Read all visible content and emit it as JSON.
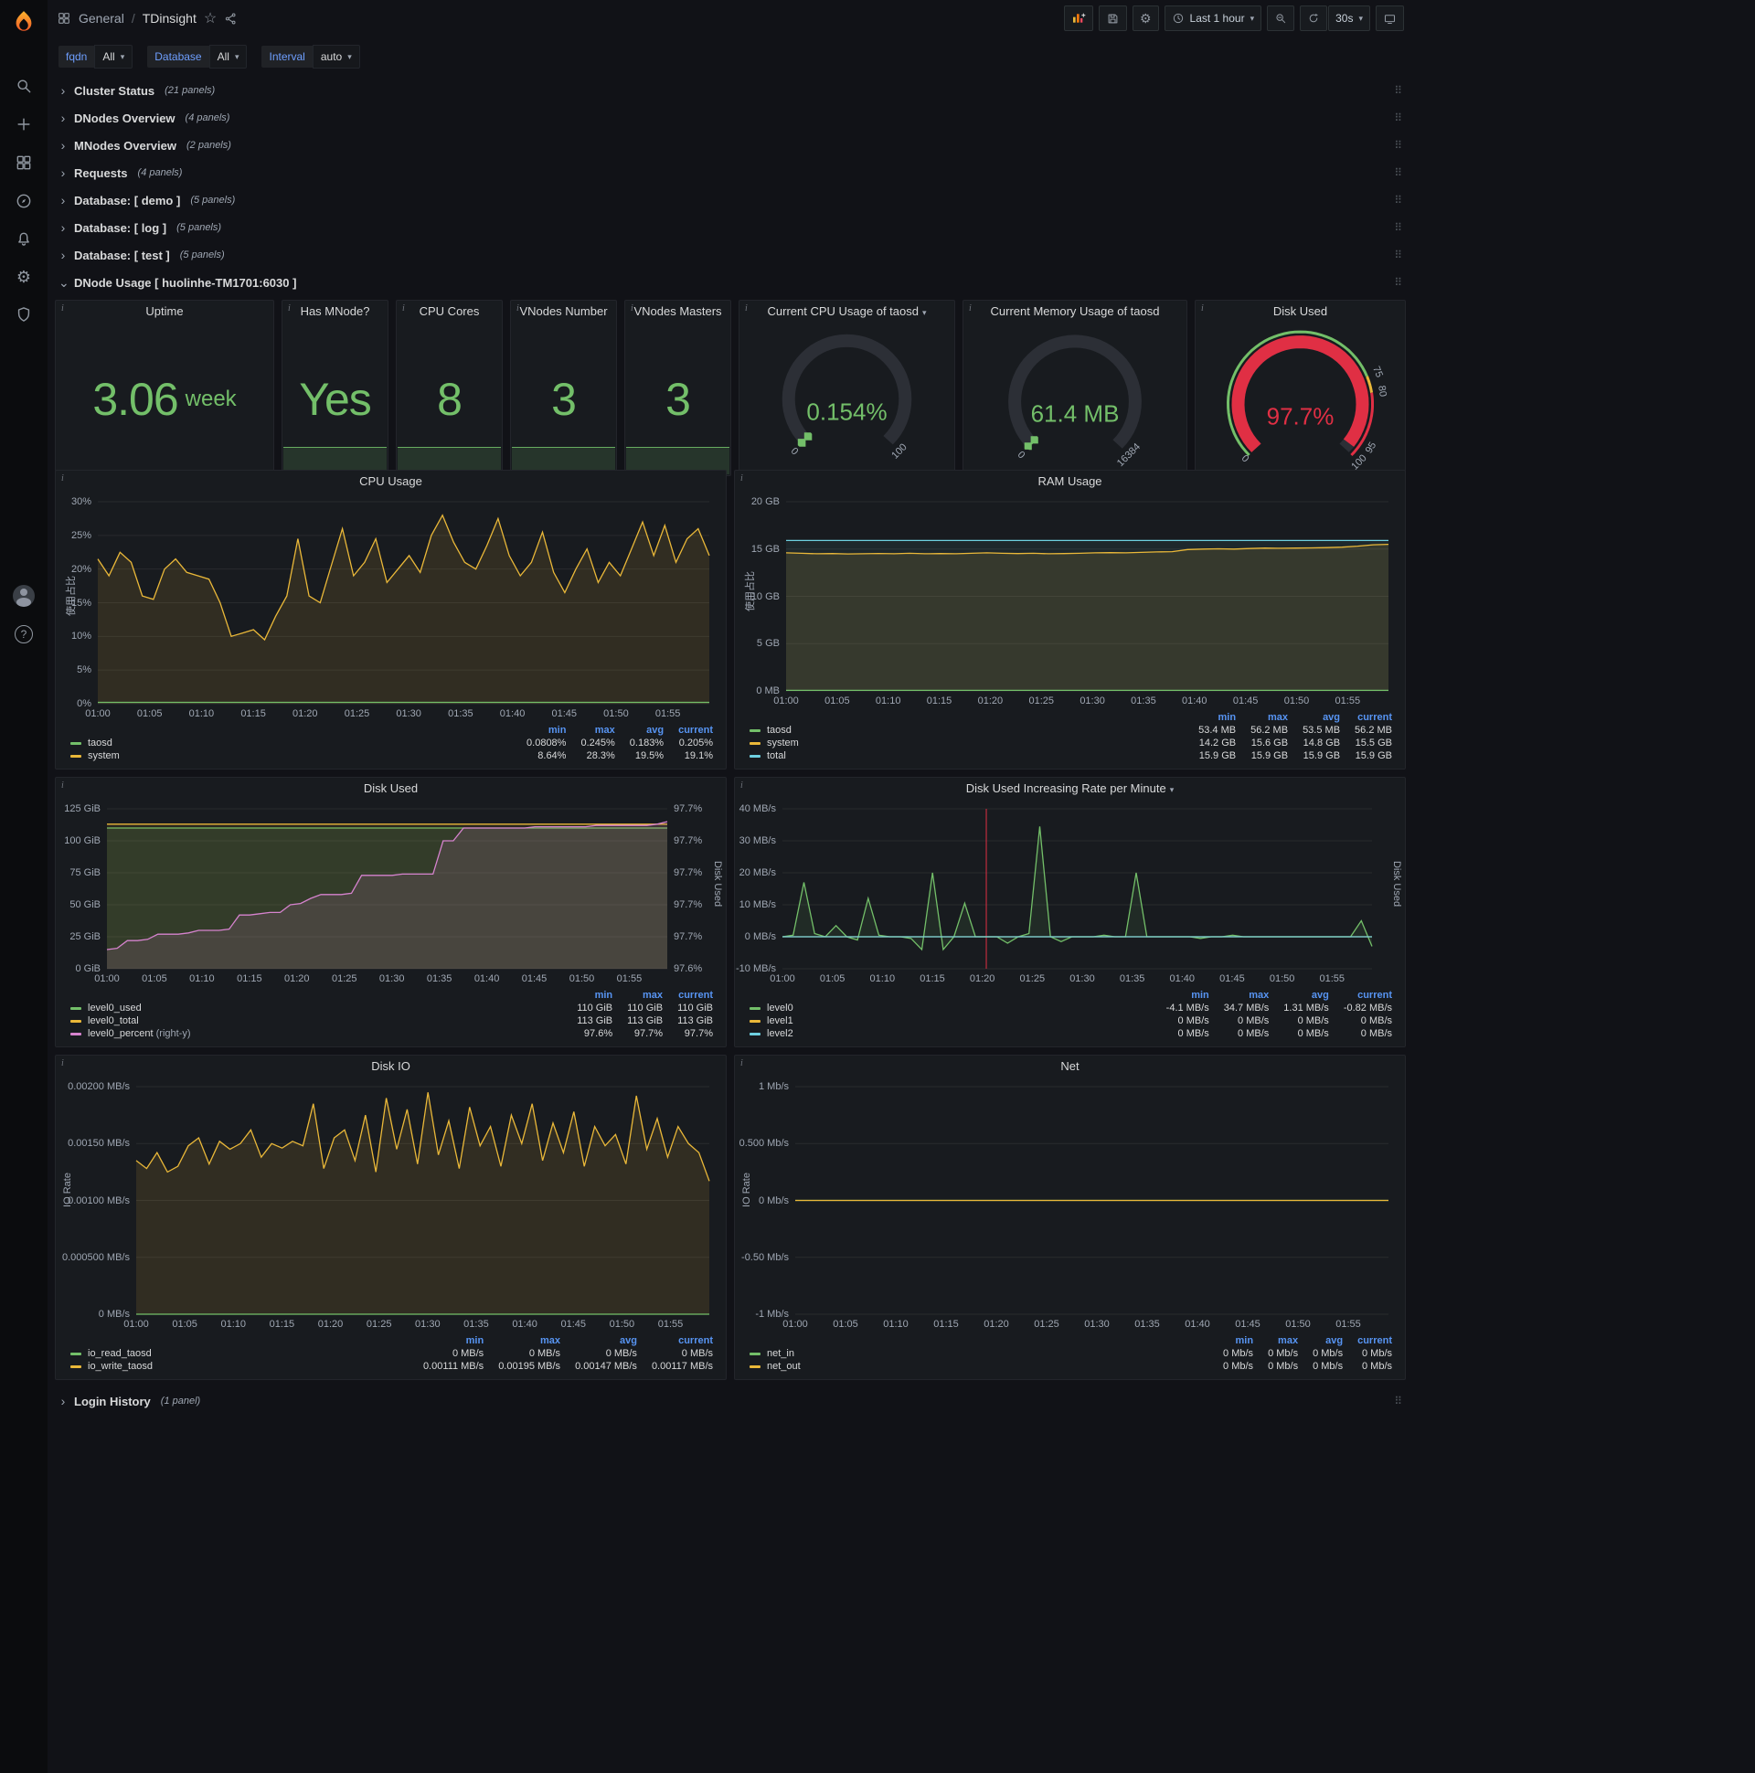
{
  "colors": {
    "green": "#73bf69",
    "yellow": "#eab839",
    "cyan": "#6ed0e0",
    "blue": "#5794f2",
    "pink": "#d683ce",
    "red": "#e02f44",
    "orange": "#ff780a"
  },
  "icons": {
    "caret": "▾",
    "chevron_right": "›",
    "chevron_down": "⌄",
    "drag": "⠿",
    "star": "☆",
    "question": "?"
  },
  "nav": {
    "folder": "General",
    "separator": "/",
    "title": "TDinsight",
    "time_range": "Last 1 hour",
    "refresh": "30s"
  },
  "filters": [
    {
      "label": "fqdn",
      "value": "All"
    },
    {
      "label": "Database",
      "value": "All"
    },
    {
      "label": "Interval",
      "value": "auto"
    }
  ],
  "rows": {
    "collapsed_top": [
      {
        "title": "Cluster Status",
        "count": "(21 panels)"
      },
      {
        "title": "DNodes Overview",
        "count": "(4 panels)"
      },
      {
        "title": "MNodes Overview",
        "count": "(2 panels)"
      },
      {
        "title": "Requests",
        "count": "(4 panels)"
      },
      {
        "title": "Database: [ demo ]",
        "count": "(5 panels)"
      },
      {
        "title": "Database: [ log ]",
        "count": "(5 panels)"
      },
      {
        "title": "Database: [ test ]",
        "count": "(5 panels)"
      }
    ],
    "expanded": {
      "title": "DNode Usage [ huolinhe-TM1701:6030 ]",
      "count": ""
    },
    "collapsed_bottom": [
      {
        "title": "Login History",
        "count": "(1 panel)"
      }
    ]
  },
  "stat_panels": [
    {
      "title": "Uptime",
      "value": "3.06",
      "unit": "week",
      "spark": false
    },
    {
      "title": "Has MNode?",
      "value": "Yes",
      "unit": "",
      "spark": true
    },
    {
      "title": "CPU Cores",
      "value": "8",
      "unit": "",
      "spark": true
    },
    {
      "title": "VNodes Number",
      "value": "3",
      "unit": "",
      "spark": true
    },
    {
      "title": "VNodes Masters",
      "value": "3",
      "unit": "",
      "spark": true
    }
  ],
  "gauge_panels": [
    {
      "title": "Current CPU Usage of taosd",
      "has_menu": true,
      "value": "0.154%",
      "min_label": "0",
      "max_label": "100",
      "fraction": 0.0015,
      "value_color": "green",
      "band": false,
      "thresholds": []
    },
    {
      "title": "Current Memory Usage of taosd",
      "has_menu": false,
      "value": "61.4 MB",
      "min_label": "0",
      "max_label": "16384",
      "fraction": 0.0037,
      "value_color": "green",
      "band": false,
      "thresholds": []
    },
    {
      "title": "Disk Used",
      "has_menu": false,
      "value": "97.7%",
      "min_label": "0",
      "max_label": "",
      "fraction": 0.977,
      "value_color": "red",
      "band": true,
      "thresholds": [
        {
          "v": 75,
          "l": "75"
        },
        {
          "v": 80,
          "l": "80"
        },
        {
          "v": 95,
          "l": "95"
        },
        {
          "v": 100,
          "l": "100"
        }
      ]
    }
  ],
  "time_axis": {
    "xlim": [
      0,
      59
    ],
    "ticks": [
      {
        "v": 0,
        "l": "01:00"
      },
      {
        "v": 5,
        "l": "01:05"
      },
      {
        "v": 10,
        "l": "01:10"
      },
      {
        "v": 15,
        "l": "01:15"
      },
      {
        "v": 20,
        "l": "01:20"
      },
      {
        "v": 25,
        "l": "01:25"
      },
      {
        "v": 30,
        "l": "01:30"
      },
      {
        "v": 35,
        "l": "01:35"
      },
      {
        "v": 40,
        "l": "01:40"
      },
      {
        "v": 45,
        "l": "01:45"
      },
      {
        "v": 50,
        "l": "01:50"
      },
      {
        "v": 55,
        "l": "01:55"
      }
    ]
  },
  "chart_data": [
    {
      "id": "cpu",
      "type": "line",
      "title": "CPU Usage",
      "has_menu": false,
      "ylabel": "使用占比",
      "ylim": [
        0,
        30
      ],
      "yticks": [
        {
          "v": 0,
          "l": "0%"
        },
        {
          "v": 5,
          "l": "5%"
        },
        {
          "v": 10,
          "l": "10%"
        },
        {
          "v": 15,
          "l": "15%"
        },
        {
          "v": 20,
          "l": "20%"
        },
        {
          "v": 25,
          "l": "25%"
        },
        {
          "v": 30,
          "l": "30%"
        }
      ],
      "series": [
        {
          "name": "system",
          "color": "yellow",
          "fill": true,
          "fill_alpha": 0.12,
          "points": [
            21.5,
            19,
            22.5,
            21,
            16,
            15.5,
            20,
            21.5,
            19.5,
            19,
            18.5,
            15,
            10,
            10.5,
            11,
            9.5,
            13,
            16,
            24.5,
            16,
            15,
            20.5,
            26,
            19,
            21,
            24.5,
            18,
            20,
            22,
            19.5,
            25,
            28,
            24,
            21,
            20,
            23.5,
            27.5,
            22,
            19,
            21,
            25.5,
            19.5,
            16.5,
            20,
            23,
            18,
            21,
            19,
            23,
            27,
            22,
            26.5,
            21,
            24.5,
            26,
            22
          ]
        },
        {
          "name": "taosd",
          "color": "green",
          "fill": false,
          "points": [
            0.2,
            0.2
          ]
        }
      ],
      "legend": {
        "cols": [
          "min",
          "max",
          "avg",
          "current"
        ],
        "rows": [
          {
            "name": "taosd",
            "color": "green",
            "vals": [
              "0.0808%",
              "0.245%",
              "0.183%",
              "0.205%"
            ]
          },
          {
            "name": "system",
            "color": "yellow",
            "vals": [
              "8.64%",
              "28.3%",
              "19.5%",
              "19.1%"
            ]
          }
        ]
      }
    },
    {
      "id": "ram",
      "type": "line",
      "title": "RAM Usage",
      "has_menu": false,
      "ylabel": "使用占比",
      "ylim": [
        0,
        20
      ],
      "yticks": [
        {
          "v": 0,
          "l": "0 MB"
        },
        {
          "v": 5,
          "l": "5 GB"
        },
        {
          "v": 10,
          "l": "10 GB"
        },
        {
          "v": 15,
          "l": "15 GB"
        },
        {
          "v": 20,
          "l": "20 GB"
        }
      ],
      "series": [
        {
          "name": "total",
          "color": "cyan",
          "fill": true,
          "fill_alpha": 0.07,
          "points": [
            15.9,
            15.9
          ]
        },
        {
          "name": "system",
          "color": "yellow",
          "fill": true,
          "fill_alpha": 0.12,
          "points": [
            14.6,
            14.55,
            14.5,
            14.52,
            14.48,
            14.5,
            14.53,
            14.5,
            14.55,
            14.5,
            14.52,
            14.5,
            14.55,
            14.6,
            14.55,
            14.52,
            14.55,
            14.5,
            14.52,
            14.55,
            14.6,
            14.62,
            14.6,
            14.65,
            14.7,
            14.72,
            14.95,
            15.0,
            15.02,
            15.0,
            15.05,
            15.1,
            15.08,
            15.1,
            15.12,
            15.15,
            15.2,
            15.3,
            15.45,
            15.5
          ]
        },
        {
          "name": "taosd",
          "color": "green",
          "fill": false,
          "points": [
            0.055,
            0.055
          ]
        }
      ],
      "legend": {
        "cols": [
          "min",
          "max",
          "avg",
          "current"
        ],
        "rows": [
          {
            "name": "taosd",
            "color": "green",
            "vals": [
              "53.4 MB",
              "56.2 MB",
              "53.5 MB",
              "56.2 MB"
            ]
          },
          {
            "name": "system",
            "color": "yellow",
            "vals": [
              "14.2 GB",
              "15.6 GB",
              "14.8 GB",
              "15.5 GB"
            ]
          },
          {
            "name": "total",
            "color": "cyan",
            "vals": [
              "15.9 GB",
              "15.9 GB",
              "15.9 GB",
              "15.9 GB"
            ]
          }
        ]
      }
    },
    {
      "id": "disk",
      "type": "line",
      "title": "Disk Used",
      "has_menu": false,
      "ylim": [
        0,
        125
      ],
      "yticks": [
        {
          "v": 0,
          "l": "0 GiB"
        },
        {
          "v": 25,
          "l": "25 GiB"
        },
        {
          "v": 50,
          "l": "50 GiB"
        },
        {
          "v": 75,
          "l": "75 GiB"
        },
        {
          "v": 100,
          "l": "100 GiB"
        },
        {
          "v": 125,
          "l": "125 GiB"
        }
      ],
      "right_ylim": [
        97.59,
        97.715
      ],
      "right_yticks": [
        {
          "f": 0,
          "l": "97.6%"
        },
        {
          "f": 0.2,
          "l": "97.7%"
        },
        {
          "f": 0.4,
          "l": "97.7%"
        },
        {
          "f": 0.6,
          "l": "97.7%"
        },
        {
          "f": 0.8,
          "l": "97.7%"
        },
        {
          "f": 1,
          "l": "97.7%"
        }
      ],
      "right_ylabel": "Disk Used",
      "series": [
        {
          "name": "level0_used",
          "color": "green",
          "fill": true,
          "fill_alpha": 0.14,
          "points": [
            110,
            110
          ]
        },
        {
          "name": "level0_total",
          "color": "yellow",
          "fill": true,
          "fill_alpha": 0.08,
          "points": [
            113,
            113
          ]
        },
        {
          "name": "level0_percent",
          "color": "pink",
          "axis": "right",
          "fill": true,
          "fill_alpha": 0.13,
          "points": [
            97.605,
            97.606,
            97.612,
            97.612,
            97.613,
            97.617,
            97.617,
            97.617,
            97.618,
            97.62,
            97.62,
            97.62,
            97.621,
            97.632,
            97.632,
            97.633,
            97.634,
            97.634,
            97.64,
            97.641,
            97.645,
            97.648,
            97.648,
            97.648,
            97.649,
            97.663,
            97.663,
            97.663,
            97.663,
            97.664,
            97.664,
            97.664,
            97.664,
            97.69,
            97.69,
            97.7,
            97.7,
            97.7,
            97.7,
            97.7,
            97.7,
            97.7,
            97.701,
            97.701,
            97.701,
            97.701,
            97.701,
            97.701,
            97.702,
            97.702,
            97.702,
            97.702,
            97.702,
            97.702,
            97.703,
            97.705
          ]
        }
      ],
      "legend": {
        "cols": [
          "min",
          "max",
          "current"
        ],
        "rows": [
          {
            "name": "level0_used",
            "color": "green",
            "vals": [
              "110 GiB",
              "110 GiB",
              "110 GiB"
            ]
          },
          {
            "name": "level0_total",
            "color": "yellow",
            "vals": [
              "113 GiB",
              "113 GiB",
              "113 GiB"
            ]
          },
          {
            "name": "level0_percent",
            "suffix": "(right-y)",
            "color": "pink",
            "vals": [
              "97.6%",
              "97.7%",
              "97.7%"
            ]
          }
        ]
      }
    },
    {
      "id": "rate",
      "type": "line",
      "title": "Disk Used Increasing Rate per Minute",
      "has_menu": true,
      "ylim": [
        -10,
        40
      ],
      "yticks": [
        {
          "v": -10,
          "l": "-10 MB/s"
        },
        {
          "v": 0,
          "l": "0 MB/s"
        },
        {
          "v": 10,
          "l": "10 MB/s"
        },
        {
          "v": 20,
          "l": "20 MB/s"
        },
        {
          "v": 30,
          "l": "30 MB/s"
        },
        {
          "v": 40,
          "l": "40 MB/s"
        }
      ],
      "right_ylabel": "Disk Used",
      "annotations": [
        {
          "x": 20.4,
          "color": "red"
        }
      ],
      "series": [
        {
          "name": "level0",
          "color": "green",
          "fill": true,
          "fill_alpha": 0.1,
          "points": [
            0,
            0.5,
            17,
            1,
            0,
            3.5,
            0,
            -1,
            12,
            0.5,
            0,
            0,
            -0.5,
            -4,
            20,
            -4,
            0,
            10.5,
            0,
            0,
            0,
            -2,
            0,
            1,
            34.5,
            0,
            -1.5,
            0,
            0,
            0,
            0.5,
            0,
            0,
            20,
            0,
            0,
            0,
            0,
            0,
            -0.5,
            0,
            0,
            0.5,
            0,
            0,
            0,
            0,
            0,
            0,
            0,
            0,
            0,
            0,
            0,
            5,
            -3
          ]
        },
        {
          "name": "level1",
          "color": "yellow",
          "fill": false,
          "points": [
            0,
            0
          ]
        },
        {
          "name": "level2",
          "color": "cyan",
          "fill": false,
          "points": [
            0,
            0
          ]
        }
      ],
      "legend": {
        "cols": [
          "min",
          "max",
          "avg",
          "current"
        ],
        "rows": [
          {
            "name": "level0",
            "color": "green",
            "vals": [
              "-4.1 MB/s",
              "34.7 MB/s",
              "1.31 MB/s",
              "-0.82 MB/s"
            ]
          },
          {
            "name": "level1",
            "color": "yellow",
            "vals": [
              "0 MB/s",
              "0 MB/s",
              "0 MB/s",
              "0 MB/s"
            ]
          },
          {
            "name": "level2",
            "color": "cyan",
            "vals": [
              "0 MB/s",
              "0 MB/s",
              "0 MB/s",
              "0 MB/s"
            ]
          }
        ]
      }
    },
    {
      "id": "io",
      "type": "line",
      "title": "Disk IO",
      "has_menu": false,
      "ylabel": "IO Rate",
      "ylim": [
        0,
        0.002
      ],
      "yticks": [
        {
          "v": 0,
          "l": "0 MB/s"
        },
        {
          "v": 0.0005,
          "l": "0.000500 MB/s"
        },
        {
          "v": 0.001,
          "l": "0.00100 MB/s"
        },
        {
          "v": 0.0015,
          "l": "0.00150 MB/s"
        },
        {
          "v": 0.002,
          "l": "0.00200 MB/s"
        }
      ],
      "series": [
        {
          "name": "io_write_taosd",
          "color": "yellow",
          "fill": true,
          "fill_alpha": 0.12,
          "points": [
            0.00135,
            0.00128,
            0.00142,
            0.00125,
            0.0013,
            0.00148,
            0.00155,
            0.00132,
            0.00152,
            0.00145,
            0.0015,
            0.00162,
            0.00138,
            0.0015,
            0.00146,
            0.00152,
            0.00148,
            0.00185,
            0.00128,
            0.00155,
            0.00162,
            0.00135,
            0.00175,
            0.00125,
            0.0019,
            0.00145,
            0.0018,
            0.00132,
            0.00195,
            0.0014,
            0.0017,
            0.00128,
            0.00182,
            0.00148,
            0.00165,
            0.0013,
            0.00175,
            0.0015,
            0.00185,
            0.00135,
            0.00168,
            0.00142,
            0.00178,
            0.0013,
            0.00165,
            0.00148,
            0.00158,
            0.00132,
            0.00192,
            0.00145,
            0.00172,
            0.00138,
            0.00165,
            0.0015,
            0.00142,
            0.00117
          ]
        },
        {
          "name": "io_read_taosd",
          "color": "green",
          "fill": false,
          "points": [
            0,
            0
          ]
        }
      ],
      "legend": {
        "cols": [
          "min",
          "max",
          "avg",
          "current"
        ],
        "rows": [
          {
            "name": "io_read_taosd",
            "color": "green",
            "vals": [
              "0 MB/s",
              "0 MB/s",
              "0 MB/s",
              "0 MB/s"
            ]
          },
          {
            "name": "io_write_taosd",
            "color": "yellow",
            "vals": [
              "0.00111 MB/s",
              "0.00195 MB/s",
              "0.00147 MB/s",
              "0.00117 MB/s"
            ]
          }
        ]
      }
    },
    {
      "id": "net",
      "type": "line",
      "title": "Net",
      "has_menu": false,
      "ylabel": "IO Rate",
      "ylim": [
        -1,
        1
      ],
      "yticks": [
        {
          "v": -1,
          "l": "-1 Mb/s"
        },
        {
          "v": -0.5,
          "l": "-0.50 Mb/s"
        },
        {
          "v": 0,
          "l": "0 Mb/s"
        },
        {
          "v": 0.5,
          "l": "0.500 Mb/s"
        },
        {
          "v": 1,
          "l": "1 Mb/s"
        }
      ],
      "series": [
        {
          "name": "net_in",
          "color": "green",
          "fill": false,
          "points": [
            0,
            0
          ]
        },
        {
          "name": "net_out",
          "color": "yellow",
          "fill": false,
          "points": [
            0,
            0
          ]
        }
      ],
      "legend": {
        "cols": [
          "min",
          "max",
          "avg",
          "current"
        ],
        "rows": [
          {
            "name": "net_in",
            "color": "green",
            "vals": [
              "0 Mb/s",
              "0 Mb/s",
              "0 Mb/s",
              "0 Mb/s"
            ]
          },
          {
            "name": "net_out",
            "color": "yellow",
            "vals": [
              "0 Mb/s",
              "0 Mb/s",
              "0 Mb/s",
              "0 Mb/s"
            ]
          }
        ]
      }
    }
  ]
}
